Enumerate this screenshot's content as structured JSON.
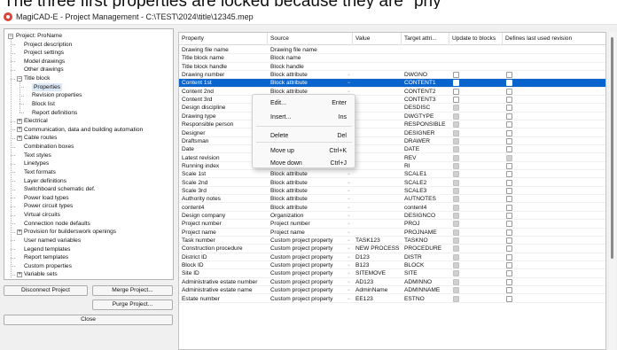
{
  "caption": "The three first properties are locked because they are \"phy",
  "window_title": "MagiCAD-E - Project Management - C:\\TEST\\2024\\title\\12345.mep",
  "tree": {
    "items": [
      {
        "label": "Project: ProName",
        "level": 0,
        "toggle": "−"
      },
      {
        "label": "Project description",
        "level": 1
      },
      {
        "label": "Project settings",
        "level": 1
      },
      {
        "label": "Model drawings",
        "level": 1
      },
      {
        "label": "Other drawings",
        "level": 1
      },
      {
        "label": "Title block",
        "level": 1,
        "toggle": "−"
      },
      {
        "label": "Properties",
        "level": 2,
        "selected": true
      },
      {
        "label": "Revision properties",
        "level": 2
      },
      {
        "label": "Block list",
        "level": 2
      },
      {
        "label": "Report definitions",
        "level": 2
      },
      {
        "label": "Electrical",
        "level": 1,
        "toggle": "+"
      },
      {
        "label": "Communication, data and building automation",
        "level": 1,
        "toggle": "+"
      },
      {
        "label": "Cable routes",
        "level": 1,
        "toggle": "+"
      },
      {
        "label": "Combination boxes",
        "level": 1
      },
      {
        "label": "Text styles",
        "level": 1
      },
      {
        "label": "Linetypes",
        "level": 1
      },
      {
        "label": "Text formats",
        "level": 1
      },
      {
        "label": "Layer definitions",
        "level": 1
      },
      {
        "label": "Switchboard schematic def.",
        "level": 1
      },
      {
        "label": "Power load types",
        "level": 1
      },
      {
        "label": "Power circuit types",
        "level": 1
      },
      {
        "label": "Virtual circuits",
        "level": 1
      },
      {
        "label": "Connection node defaults",
        "level": 1
      },
      {
        "label": "Provision for builderswork openings",
        "level": 1,
        "toggle": "+"
      },
      {
        "label": "User named variables",
        "level": 1
      },
      {
        "label": "Legend templates",
        "level": 1
      },
      {
        "label": "Report templates",
        "level": 1
      },
      {
        "label": "Custom properties",
        "level": 1
      },
      {
        "label": "Variable sets",
        "level": 1,
        "toggle": "+"
      }
    ]
  },
  "buttons": {
    "disconnect": "Disconnect Project",
    "merge": "Merge Project...",
    "purge": "Purge Project...",
    "close": "Close"
  },
  "grid": {
    "columns": [
      "Property",
      "Source",
      "Value",
      "Target attri...",
      "Update to blocks",
      "Defines last used revision"
    ],
    "rows": [
      {
        "property": "Drawing file name",
        "source": "Drawing file name",
        "value": "",
        "target": "",
        "dd": false,
        "update": "none",
        "defines": "none"
      },
      {
        "property": "Title block name",
        "source": "Block name",
        "value": "",
        "target": "",
        "dd": false,
        "update": "none",
        "defines": "none"
      },
      {
        "property": "Title block handle",
        "source": "Block handle",
        "value": "",
        "target": "",
        "dd": false,
        "update": "none",
        "defines": "none"
      },
      {
        "property": "Drawing number",
        "source": "Block attribute",
        "value": "",
        "target": "DWGNO",
        "dd": true,
        "update": "box",
        "defines": "box"
      },
      {
        "property": "Content 1st",
        "source": "Block attribute",
        "value": "",
        "target": "CONTENT1",
        "dd": true,
        "update": "box",
        "defines": "box",
        "selected": true
      },
      {
        "property": "Content 2nd",
        "source": "Block attribute",
        "value": "",
        "target": "CONTENT2",
        "dd": true,
        "update": "box",
        "defines": "box"
      },
      {
        "property": "Content 3rd",
        "source": "Block attribute",
        "value": "",
        "target": "CONTENT3",
        "dd": true,
        "update": "box",
        "defines": "box"
      },
      {
        "property": "Design discipline",
        "source": "Block attribute",
        "value": "",
        "target": "DESDISC",
        "dd": true,
        "update": "dis",
        "defines": "box"
      },
      {
        "property": "Drawing type",
        "source": "Block attribute",
        "value": "",
        "target": "DWGTYPE",
        "dd": true,
        "update": "dis",
        "defines": "box"
      },
      {
        "property": "Responsible person",
        "source": "Block attribute",
        "value": "",
        "target": "RESPONSIBLE",
        "dd": true,
        "update": "dis",
        "defines": "box"
      },
      {
        "property": "Designer",
        "source": "Block attribute",
        "value": "",
        "target": "DESIGNER",
        "dd": true,
        "update": "dis",
        "defines": "box"
      },
      {
        "property": "Draftsman",
        "source": "Block attribute",
        "value": "",
        "target": "DRAWER",
        "dd": true,
        "update": "dis",
        "defines": "box"
      },
      {
        "property": "Date",
        "source": "Block attribute",
        "value": "",
        "target": "DATE",
        "dd": true,
        "update": "dis",
        "defines": "box"
      },
      {
        "property": "Latest revision",
        "source": "Block attribute",
        "value": "",
        "target": "REV",
        "dd": true,
        "update": "dis",
        "defines": "dis"
      },
      {
        "property": "Running index",
        "source": "Block attribute",
        "value": "",
        "target": "RI",
        "dd": true,
        "update": "dis",
        "defines": "box"
      },
      {
        "property": "Scale 1st",
        "source": "Block attribute",
        "value": "",
        "target": "SCALE1",
        "dd": true,
        "update": "dis",
        "defines": "box"
      },
      {
        "property": "Scale 2nd",
        "source": "Block attribute",
        "value": "",
        "target": "SCALE2",
        "dd": true,
        "update": "dis",
        "defines": "box"
      },
      {
        "property": "Scale 3rd",
        "source": "Block attribute",
        "value": "",
        "target": "SCALE3",
        "dd": true,
        "update": "dis",
        "defines": "box"
      },
      {
        "property": "Authority notes",
        "source": "Block attribute",
        "value": "",
        "target": "AUTNOTES",
        "dd": true,
        "update": "dis",
        "defines": "box"
      },
      {
        "property": "content4",
        "source": "Block attribute",
        "value": "",
        "target": "content4",
        "dd": true,
        "update": "dis",
        "defines": "box"
      },
      {
        "property": "Design company",
        "source": "Organization",
        "value": "",
        "target": "DESIGNCO",
        "dd": true,
        "update": "dis",
        "defines": "box"
      },
      {
        "property": "Project number",
        "source": "Project number",
        "value": "",
        "target": "PROJ",
        "dd": true,
        "update": "dis",
        "defines": "box"
      },
      {
        "property": "Project name",
        "source": "Project name",
        "value": "",
        "target": "PROJNAME",
        "dd": true,
        "update": "dis",
        "defines": "box"
      },
      {
        "property": "Task number",
        "source": "Custom project property",
        "value": "TASK123",
        "target": "TASKNO",
        "dd": true,
        "update": "dis",
        "defines": "box"
      },
      {
        "property": "Construction procedure",
        "source": "Custom project property",
        "value": "NEW PROCESS",
        "target": "PROCEDURE",
        "dd": true,
        "update": "dis",
        "defines": "box"
      },
      {
        "property": "District ID",
        "source": "Custom project property",
        "value": "D123",
        "target": "DISTR",
        "dd": true,
        "update": "dis",
        "defines": "box"
      },
      {
        "property": "Block ID",
        "source": "Custom project property",
        "value": "B123",
        "target": "BLOCK",
        "dd": true,
        "update": "dis",
        "defines": "box"
      },
      {
        "property": "Site ID",
        "source": "Custom project property",
        "value": "SITEMOVE",
        "target": "SITE",
        "dd": true,
        "update": "dis",
        "defines": "box"
      },
      {
        "property": "Administrative estate number",
        "source": "Custom project property",
        "value": "AD123",
        "target": "ADMINNO",
        "dd": true,
        "update": "dis",
        "defines": "box"
      },
      {
        "property": "Administrative estate name",
        "source": "Custom project property",
        "value": "AdminName",
        "target": "ADMINNAME",
        "dd": true,
        "update": "dis",
        "defines": "box"
      },
      {
        "property": "Estate number",
        "source": "Custom project property",
        "value": "EE123",
        "target": "ESTNO",
        "dd": true,
        "update": "dis",
        "defines": "box"
      }
    ]
  },
  "context_menu": {
    "items": [
      {
        "label": "Edit...",
        "shortcut": "Enter"
      },
      {
        "label": "Insert...",
        "shortcut": "Ins"
      },
      {
        "label": "Delete",
        "shortcut": "Del"
      },
      {
        "label": "Move up",
        "shortcut": "Ctrl+K"
      },
      {
        "label": "Move down",
        "shortcut": "Ctrl+J"
      }
    ]
  },
  "colors": {
    "selection": "#0a64ce",
    "tree_selection": "#dde8f7"
  }
}
